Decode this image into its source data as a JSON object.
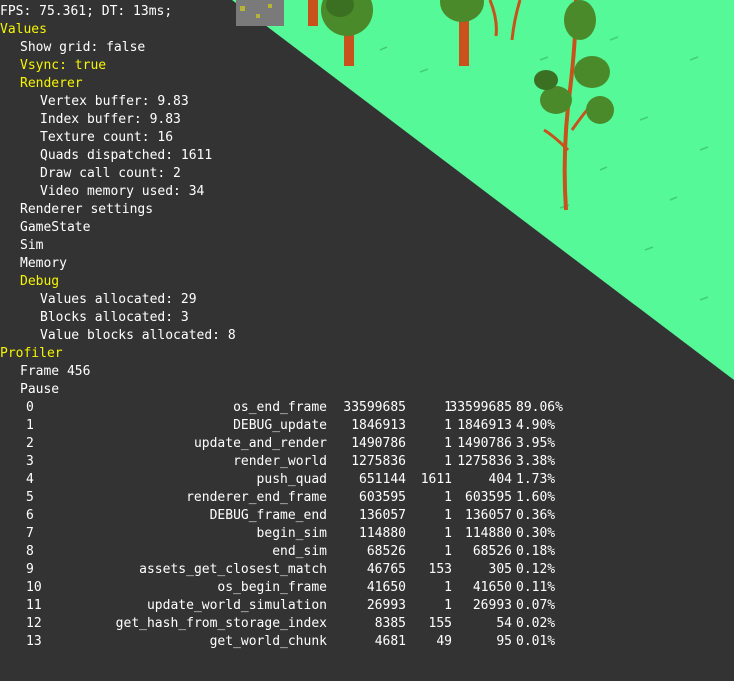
{
  "colors": {
    "grass": "#55f998",
    "background": "#333333",
    "highlight": "#f6f600",
    "text": "#ffffff",
    "trunk": "#c8521c",
    "foliage": "#4a8a2a",
    "foliage_dark": "#3b6f22",
    "rock": "#7a7a7a"
  },
  "hud": {
    "fps_line": "FPS: 75.361; DT: 13ms;"
  },
  "debug_tree": {
    "values_label": "Values",
    "show_grid": "Show grid: false",
    "vsync": "Vsync: true",
    "renderer_label": "Renderer",
    "renderer_items": [
      "Vertex buffer: 9.83",
      "Index buffer: 9.83",
      "Texture count: 16",
      "Quads dispatched: 1611",
      "Draw call count: 2",
      "Video memory used: 34"
    ],
    "renderer_settings": "Renderer settings",
    "gamestate": "GameState",
    "sim": "Sim",
    "memory": "Memory",
    "debug_label": "Debug",
    "debug_items": [
      "Values allocated: 29",
      "Blocks allocated: 3",
      "Value blocks allocated: 8"
    ],
    "profiler_label": "Profiler",
    "frame": "Frame 456",
    "pause": "Pause"
  },
  "profiler_rows": [
    {
      "idx": "0",
      "name": "os_end_frame",
      "cycles": "33599685",
      "hits": "1",
      "cph": "33599685",
      "pct": "89.06%"
    },
    {
      "idx": "1",
      "name": "DEBUG_update",
      "cycles": "1846913",
      "hits": "1",
      "cph": "1846913",
      "pct": "4.90%"
    },
    {
      "idx": "2",
      "name": "update_and_render",
      "cycles": "1490786",
      "hits": "1",
      "cph": "1490786",
      "pct": "3.95%"
    },
    {
      "idx": "3",
      "name": "render_world",
      "cycles": "1275836",
      "hits": "1",
      "cph": "1275836",
      "pct": "3.38%"
    },
    {
      "idx": "4",
      "name": "push_quad",
      "cycles": "651144",
      "hits": "1611",
      "cph": "404",
      "pct": "1.73%"
    },
    {
      "idx": "5",
      "name": "renderer_end_frame",
      "cycles": "603595",
      "hits": "1",
      "cph": "603595",
      "pct": "1.60%"
    },
    {
      "idx": "6",
      "name": "DEBUG_frame_end",
      "cycles": "136057",
      "hits": "1",
      "cph": "136057",
      "pct": "0.36%"
    },
    {
      "idx": "7",
      "name": "begin_sim",
      "cycles": "114880",
      "hits": "1",
      "cph": "114880",
      "pct": "0.30%"
    },
    {
      "idx": "8",
      "name": "end_sim",
      "cycles": "68526",
      "hits": "1",
      "cph": "68526",
      "pct": "0.18%"
    },
    {
      "idx": "9",
      "name": "assets_get_closest_match",
      "cycles": "46765",
      "hits": "153",
      "cph": "305",
      "pct": "0.12%"
    },
    {
      "idx": "10",
      "name": "os_begin_frame",
      "cycles": "41650",
      "hits": "1",
      "cph": "41650",
      "pct": "0.11%"
    },
    {
      "idx": "11",
      "name": "update_world_simulation",
      "cycles": "26993",
      "hits": "1",
      "cph": "26993",
      "pct": "0.07%"
    },
    {
      "idx": "12",
      "name": "get_hash_from_storage_index",
      "cycles": "8385",
      "hits": "155",
      "cph": "54",
      "pct": "0.02%"
    },
    {
      "idx": "13",
      "name": "get_world_chunk",
      "cycles": "4681",
      "hits": "49",
      "cph": "95",
      "pct": "0.01%"
    }
  ]
}
